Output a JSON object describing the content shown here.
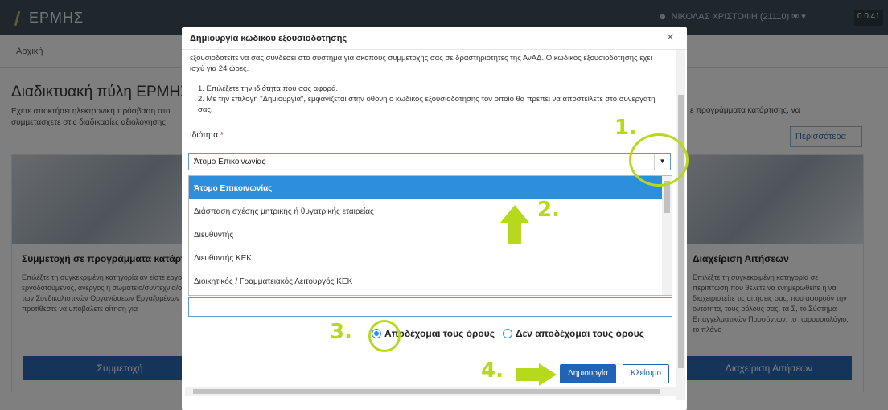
{
  "app": {
    "logo_text": "ΕΡΜΗΣ"
  },
  "topnav": {
    "user_label": "ΝΙΚΟΛΑΣ ΧΡΙΣΤΟΦΗ (21110)",
    "time": "0.0.41"
  },
  "breadcrumb": "Αρχική",
  "hero": {
    "title": "Διαδικτυακή πύλη ΕΡΜΗΣ",
    "text_line1": "Εχετε αποκτήσει ηλεκτρονική πρόσβαση στο",
    "text_line2": "συμμετάσχετε στις διαδικασίες αξιολόγησης",
    "text_right": "ε προγράμματα κατάρτισης, να",
    "more_button": "Περισσότερα"
  },
  "cards": [
    {
      "title": "Συμμετοχή σε προγράμματα κατάρτισης",
      "text": "Επιλέξτε τη συγκεκριμένη κατηγορία αν είστε εργοδότης, εργοδοτούμενος, άνεργος ή σωματείο/συντεχνία/οργάνωση των Συνδικαλιστικών Οργανώσεων Εργαζομένων και προτίθεστε να υποβάλετε αίτηση για",
      "button": "Συμμετοχή"
    },
    {
      "title": "Διαχείριση Αιτήσεων",
      "text": "Επιλέξτε τη συγκεκριμένη κατηγορία σε περίπτωση που θέλετε να ενημερωθείτε ή να διαχειριστείτε τις αιτήσεις σας, που αφορούν την οντότητα, τους ρόλους σας, τα Σ, το Σύστημα Επαγγελματικών Προσόντων, το παρουσιολόγιο, το πλάνο",
      "button": "Διαχείριση Αιτήσεων"
    }
  ],
  "modal": {
    "title": "Δημιουργία κωδικού εξουσιοδότησης",
    "close_symbol": "×",
    "intro": "εξουσιοδοτείτε να σας συνδέσει στο σύστημα για σκοπούς συμμετοχής σας σε δραστηριότητες της ΑνΑΔ. Ο κωδικός εξουσιοδότησης έχει ισχύ για 24 ώρες.",
    "steps": [
      "1. Επιλέξετε την ιδιότητα που σας αφορά.",
      "2. Με την επιλογή \"Δημιουργία\", εμφανίζεται στην οθόνη ο κωδικός εξουσιοδότησης τον οποίο θα πρέπει να αποστείλετε στο συνεργάτη σας."
    ],
    "field_label": "Ιδιότητα",
    "field_required_mark": "*",
    "selected_value": "Άτομο Επικοινωνίας",
    "options": [
      "Άτομο Επικοινωνίας",
      "Διάσπαση σχέσης μητρικής ή θυγατρικής εταιρείας",
      "Διευθυντής",
      "Διευθυντής ΚΕΚ",
      "Διοικητικός / Γραμματειακός Λειτουργός ΚΕΚ"
    ],
    "accept_terms": "Αποδέχομαι τους όρους",
    "reject_terms": "Δεν αποδέχομαι τους όρους",
    "create_button": "Δημιουργία",
    "close_button": "Κλείσιμο"
  },
  "annotations": {
    "step1": "1.",
    "step2": "2.",
    "step3": "3.",
    "step4": "4.",
    "color": "#b6d91e"
  }
}
